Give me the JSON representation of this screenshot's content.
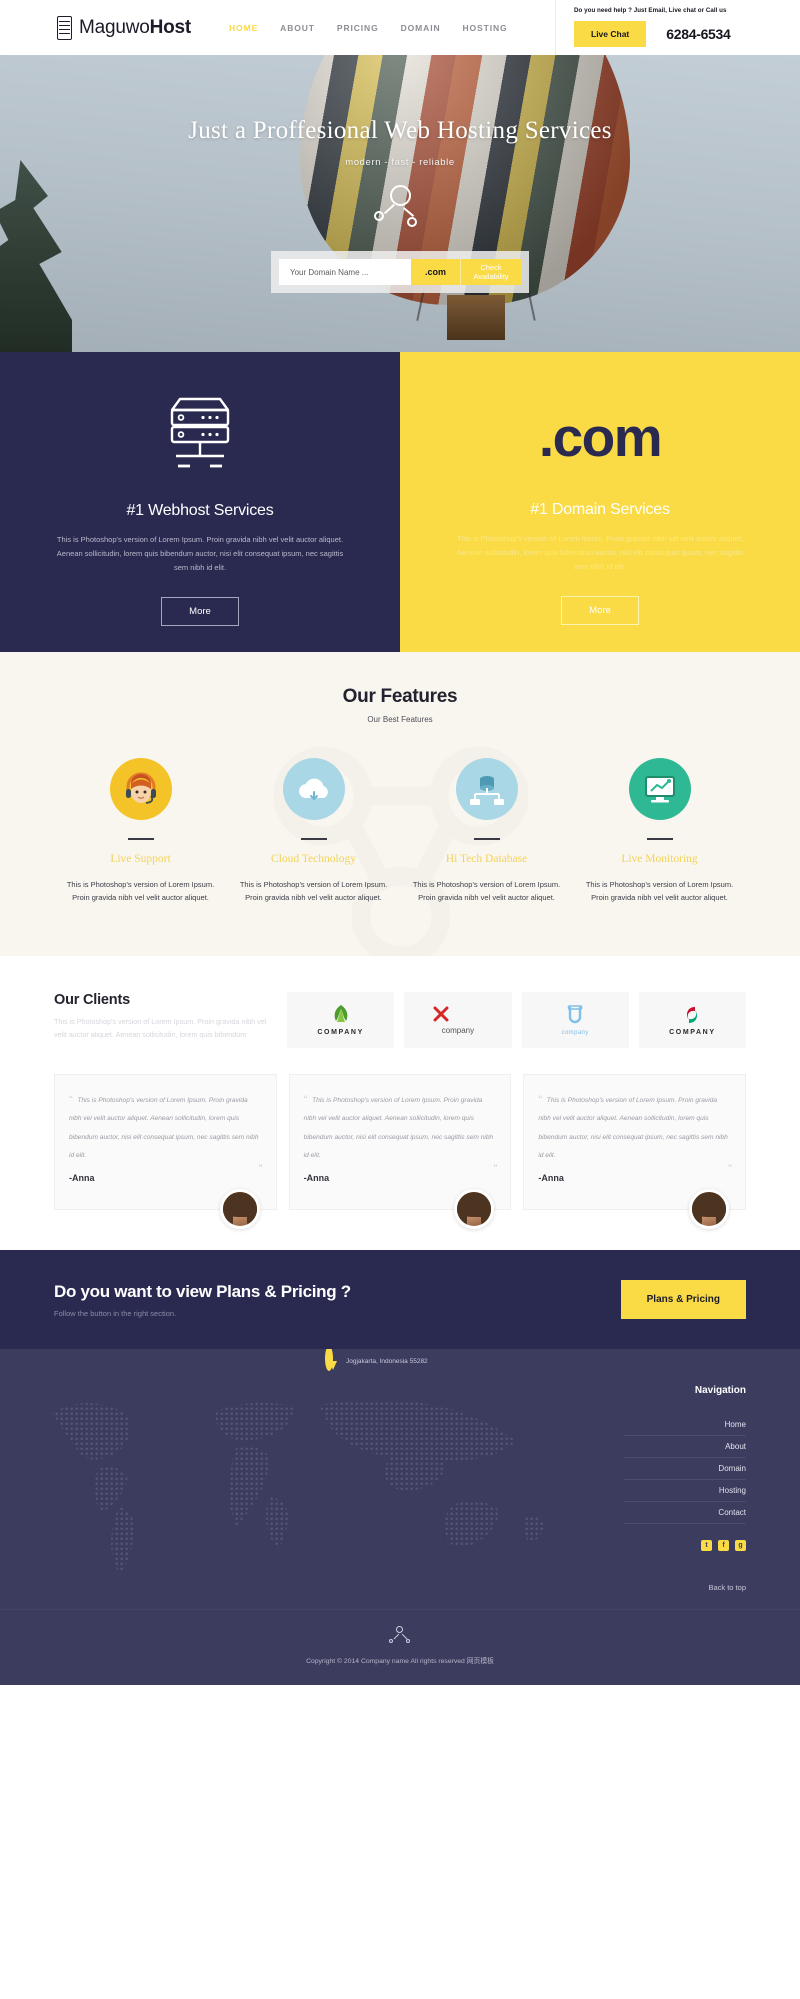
{
  "brand": {
    "light": "Maguwo",
    "bold": "Host",
    "icon": "server-icon"
  },
  "nav": {
    "items": [
      {
        "label": "HOME",
        "active": true
      },
      {
        "label": "ABOUT",
        "active": false
      },
      {
        "label": "PRICING",
        "active": false
      },
      {
        "label": "DOMAIN",
        "active": false
      },
      {
        "label": "HOSTING",
        "active": false
      }
    ]
  },
  "help": {
    "text": "Do you need help ? Just Email, Live chat or Call us",
    "live_chat_label": "Live Chat",
    "phone": "6284-6534"
  },
  "hero": {
    "title": "Just a Proffesional Web Hosting Services",
    "subtitle": "modern - fast - reliable",
    "search_placeholder": "Your Domain Name ...",
    "search_value": "",
    "tld": ".com",
    "check_label": "Check Availability"
  },
  "services": [
    {
      "title": "#1 Webhost Services",
      "body": "This is Photoshop's version of Lorem Ipsum. Proin gravida nibh vel velit auctor aliquet. Aenean sollicitudin, lorem quis bibendum auctor, nisi elit consequat ipsum, nec sagittis sem nibh id elit.",
      "more_label": "More",
      "theme": "dark"
    },
    {
      "title": "#1 Domain Services",
      "body": "This is Photoshop's version of Lorem Ipsum. Proin gravida nibh vel velit auctor aliquet. Aenean sollicitudin, lorem quis bibendum auctor, nisi elit consequat ipsum, nec sagittis sem nibh id elit.",
      "more_label": "More",
      "theme": "yellow",
      "badge": ".com"
    }
  ],
  "features": {
    "title": "Our Features",
    "subtitle": "Our Best Features",
    "items": [
      {
        "title": "Live Support",
        "body": "This is Photoshop's version of Lorem Ipsum. Proin gravida nibh vel velit auctor aliquet.",
        "icon": "headset-support-icon",
        "color": "#f4c328"
      },
      {
        "title": "Cloud Technology",
        "body": "This is Photoshop's version of Lorem Ipsum. Proin gravida nibh vel velit auctor aliquet.",
        "icon": "cloud-icon",
        "color": "#aad7e6"
      },
      {
        "title": "Hi Tech Database",
        "body": "This is Photoshop's version of Lorem Ipsum. Proin gravida nibh vel velit auctor aliquet.",
        "icon": "database-icon",
        "color": "#aad7e6"
      },
      {
        "title": "Live Monitoring",
        "body": "This is Photoshop's version of Lorem Ipsum. Proin gravida nibh vel velit auctor aliquet.",
        "icon": "monitor-chart-icon",
        "color": "#2fb894"
      }
    ]
  },
  "clients": {
    "title": "Our Clients",
    "body": "This is Photoshop's version of Lorem Ipsum. Proin gravida nibh vel velit auctor aliquet. Aenean sollicitudin, lorem quis bibendum",
    "logos": [
      {
        "name": "COMPANY",
        "icon": "leaf-logo-icon"
      },
      {
        "name": "company",
        "icon": "x-logo-icon"
      },
      {
        "name": "company",
        "icon": "u-magnet-logo-icon"
      },
      {
        "name": "COMPANY",
        "icon": "swirl-logo-icon"
      }
    ]
  },
  "testimonials": [
    {
      "quote": "This is Photoshop's version of Lorem Ipsum. Proin gravida nibh vel velit auctor aliquet. Aenean sollicitudin, lorem quis bibendum auctor, nisi elit consequat ipsum, nec sagittis sem nibh id elit.",
      "author": "-Anna"
    },
    {
      "quote": "This is Photoshop's version of Lorem Ipsum. Proin gravida nibh vel velit auctor aliquet. Aenean sollicitudin, lorem quis bibendum auctor, nisi elit consequat ipsum, nec sagittis sem nibh id elit.",
      "author": "-Anna"
    },
    {
      "quote": "This is Photoshop's version of Lorem Ipsum. Proin gravida nibh vel velit auctor aliquet. Aenean sollicitudin, lorem quis bibendum auctor, nisi elit consequat ipsum, nec sagittis sem nibh id elit.",
      "author": "-Anna"
    }
  ],
  "cta": {
    "title": "Do you want to view Plans & Pricing ?",
    "subtitle": "Follow the button in the right section.",
    "button_label": "Plans & Pricing"
  },
  "footer": {
    "nav_title": "Navigation",
    "links": [
      {
        "label": "Home"
      },
      {
        "label": "About"
      },
      {
        "label": "Domain"
      },
      {
        "label": "Hosting"
      },
      {
        "label": "Contact"
      }
    ],
    "socials": [
      {
        "name": "twitter-icon",
        "glyph": "t"
      },
      {
        "name": "facebook-icon",
        "glyph": "f"
      },
      {
        "name": "google-plus-icon",
        "glyph": "g"
      }
    ],
    "back_to_top": "Back to top",
    "location": "Jogjakarta, Indonesia 55282",
    "copyright": "Copyright © 2014 Company name All rights reserved 网页模板"
  },
  "colors": {
    "accent_yellow": "#fadb45",
    "dark_navy": "#2a2a51",
    "footer_navy": "#3c3c5f",
    "cream": "#f9f6f0"
  }
}
